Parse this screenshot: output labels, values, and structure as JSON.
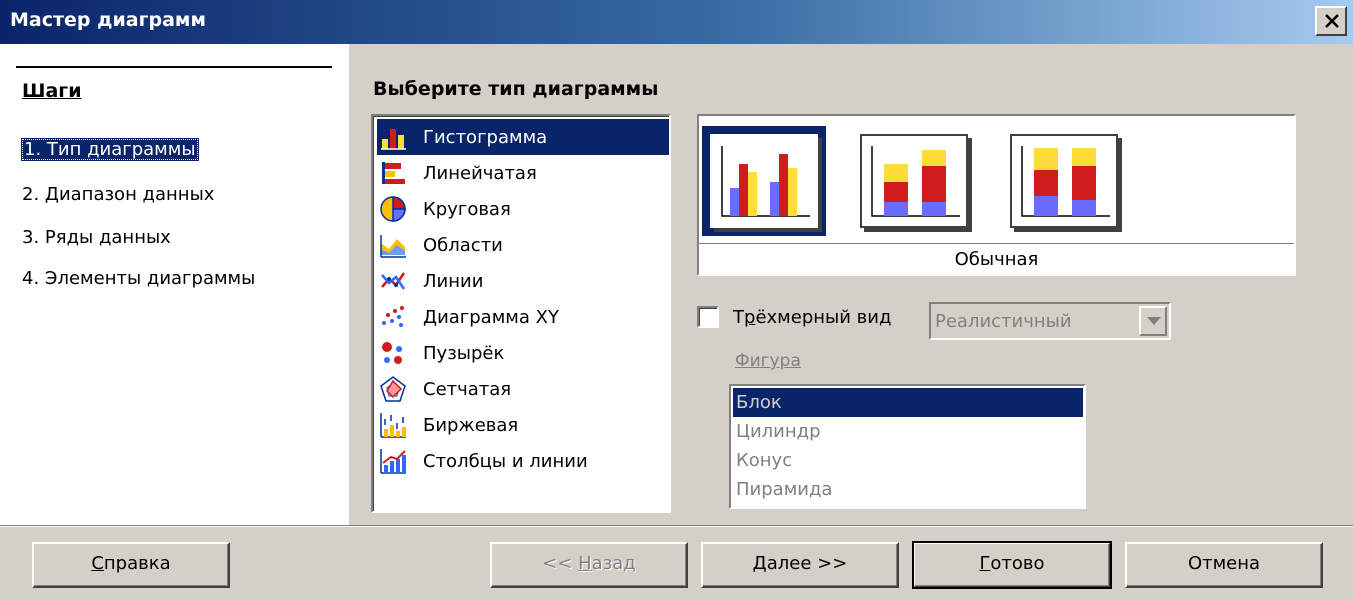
{
  "window": {
    "title": "Мастер диаграмм",
    "close_glyph": "✕"
  },
  "steps": {
    "heading": "Шаги",
    "items": [
      {
        "label": "1. Тип диаграммы",
        "active": true
      },
      {
        "label": "2. Диапазон данных"
      },
      {
        "label": "3. Ряды данных"
      },
      {
        "label": "4. Элементы диаграммы"
      }
    ]
  },
  "main": {
    "heading": "Выберите тип диаграммы",
    "chart_types": [
      {
        "label": "Гистограмма",
        "icon": "column-chart-icon",
        "selected": true
      },
      {
        "label": "Линейчатая",
        "icon": "bar-chart-icon"
      },
      {
        "label": "Круговая",
        "icon": "pie-chart-icon"
      },
      {
        "label": "Области",
        "icon": "area-chart-icon"
      },
      {
        "label": "Линии",
        "icon": "line-chart-icon"
      },
      {
        "label": "Диаграмма XY",
        "icon": "xy-scatter-icon"
      },
      {
        "label": "Пузырёк",
        "icon": "bubble-chart-icon"
      },
      {
        "label": "Сетчатая",
        "icon": "net-chart-icon"
      },
      {
        "label": "Биржевая",
        "icon": "stock-chart-icon"
      },
      {
        "label": "Столбцы и линии",
        "icon": "column-line-chart-icon"
      }
    ],
    "variants": [
      {
        "name": "normal-variant",
        "selected": true
      },
      {
        "name": "stacked-variant"
      },
      {
        "name": "percent-stacked-variant"
      }
    ],
    "variant_label": "Обычная",
    "three_d": {
      "label_prefix": "Т",
      "label_accel": "р",
      "label_rest": "ёхмерный вид",
      "checked": false,
      "scheme_value": "Реалистичный"
    },
    "shape": {
      "label": "Фигура",
      "items": [
        "Блок",
        "Цилиндр",
        "Конус",
        "Пирамида"
      ],
      "selected_index": 0
    }
  },
  "buttons": {
    "help": {
      "accel": "С",
      "rest": "правка"
    },
    "back": {
      "prefix": "<< ",
      "accel": "Н",
      "rest": "азад"
    },
    "next": {
      "accel": "Д",
      "rest": "алее >>"
    },
    "finish": {
      "accel": "Г",
      "rest": "отово"
    },
    "cancel": "Отмена"
  },
  "colors": {
    "selection": "#0a246a",
    "dialog_face": "#d4d0c8",
    "series_blue": "#6b6bff",
    "series_red": "#d01c1c",
    "series_yellow": "#ffdc3c"
  }
}
